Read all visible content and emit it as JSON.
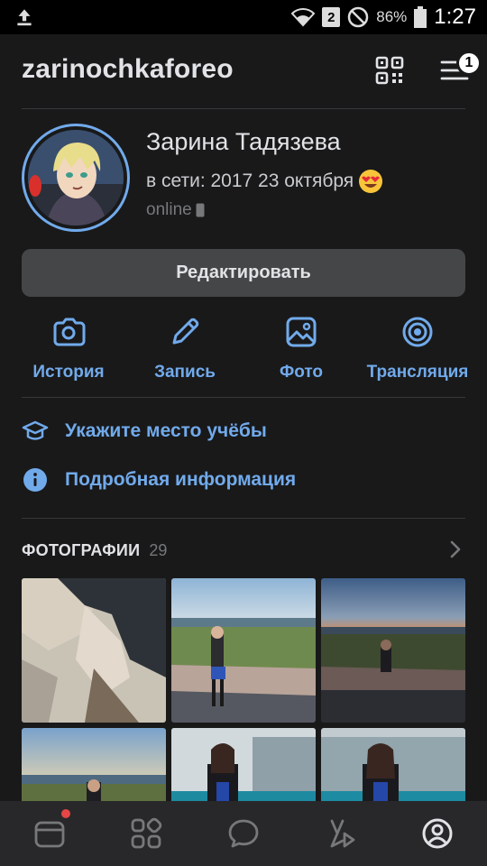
{
  "status_bar": {
    "sim_slot": "2",
    "battery": "86%",
    "time": "1:27"
  },
  "header": {
    "username": "zarinochkaforeo",
    "menu_badge": "1"
  },
  "profile": {
    "name": "Зарина Тадязева",
    "last_seen": "в сети: 2017 23 октября",
    "status": "online",
    "edit_label": "Редактировать"
  },
  "actions": [
    {
      "label": "История",
      "icon": "camera-icon"
    },
    {
      "label": "Запись",
      "icon": "pencil-icon"
    },
    {
      "label": "Фото",
      "icon": "image-icon"
    },
    {
      "label": "Трансляция",
      "icon": "broadcast-icon"
    }
  ],
  "info": {
    "education": "Укажите место учёбы",
    "details": "Подробная информация"
  },
  "photos": {
    "title": "ФОТОГРАФИИ",
    "count": "29"
  },
  "tabs": [
    "news-tab",
    "services-tab",
    "messages-tab",
    "clips-tab",
    "profile-tab"
  ],
  "colors": {
    "background": "#19191a",
    "accent": "#71aaeb",
    "button": "#454647",
    "tabbar": "#28282a",
    "notification": "#e64646"
  }
}
